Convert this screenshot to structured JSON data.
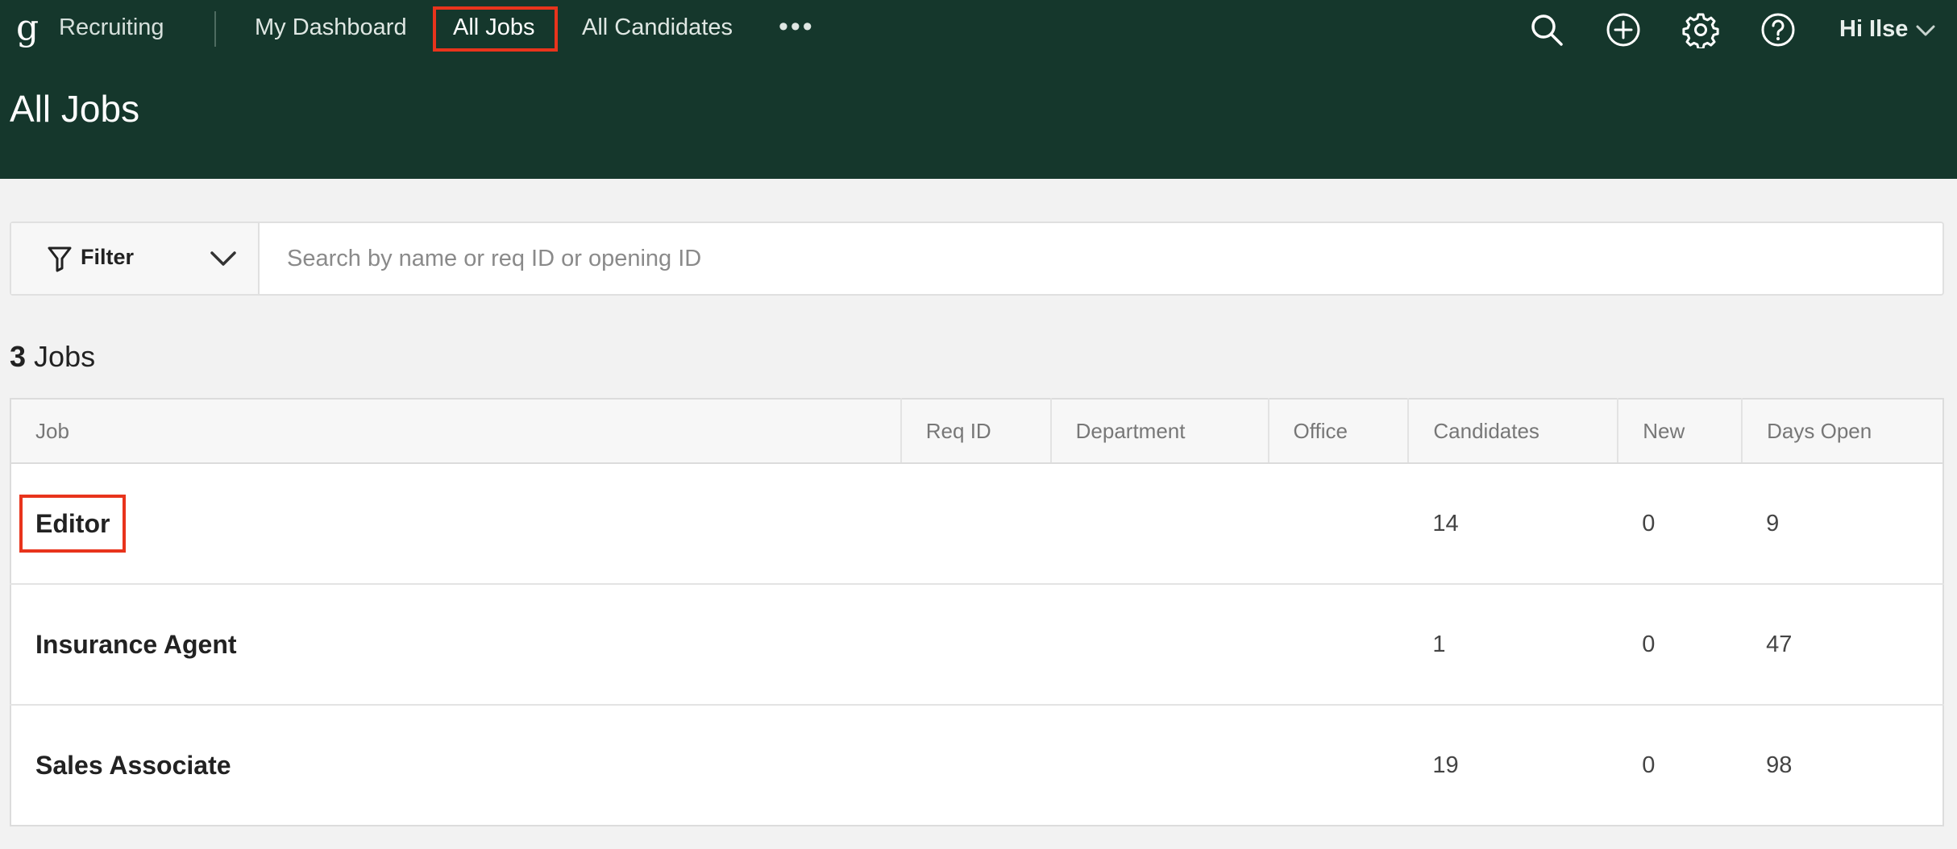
{
  "app": {
    "brand": "Recruiting",
    "logo_glyph": "g"
  },
  "nav": {
    "items": [
      {
        "label": "My Dashboard",
        "active": false
      },
      {
        "label": "All Jobs",
        "active": true
      },
      {
        "label": "All Candidates",
        "active": false
      }
    ],
    "more_label": "•••"
  },
  "header_icons": [
    "search-icon",
    "add-circle-icon",
    "settings-gear-icon",
    "help-icon"
  ],
  "user": {
    "greeting": "Hi Ilse"
  },
  "page": {
    "title": "All Jobs"
  },
  "filter": {
    "label": "Filter",
    "search_placeholder": "Search by name or req ID or opening ID",
    "search_value": ""
  },
  "jobs": {
    "count": "3",
    "count_label": "Jobs",
    "columns": [
      "Job",
      "Req ID",
      "Department",
      "Office",
      "Candidates",
      "New",
      "Days Open"
    ],
    "rows": [
      {
        "job": "Editor",
        "req_id": "",
        "department": "",
        "office": "",
        "candidates": "14",
        "new": "0",
        "days_open": "9"
      },
      {
        "job": "Insurance Agent",
        "req_id": "",
        "department": "",
        "office": "",
        "candidates": "1",
        "new": "0",
        "days_open": "47"
      },
      {
        "job": "Sales Associate",
        "req_id": "",
        "department": "",
        "office": "",
        "candidates": "19",
        "new": "0",
        "days_open": "98"
      }
    ]
  },
  "colors": {
    "header_bg": "#15372c",
    "highlight": "#e8341c",
    "page_bg": "#f2f2f2"
  }
}
